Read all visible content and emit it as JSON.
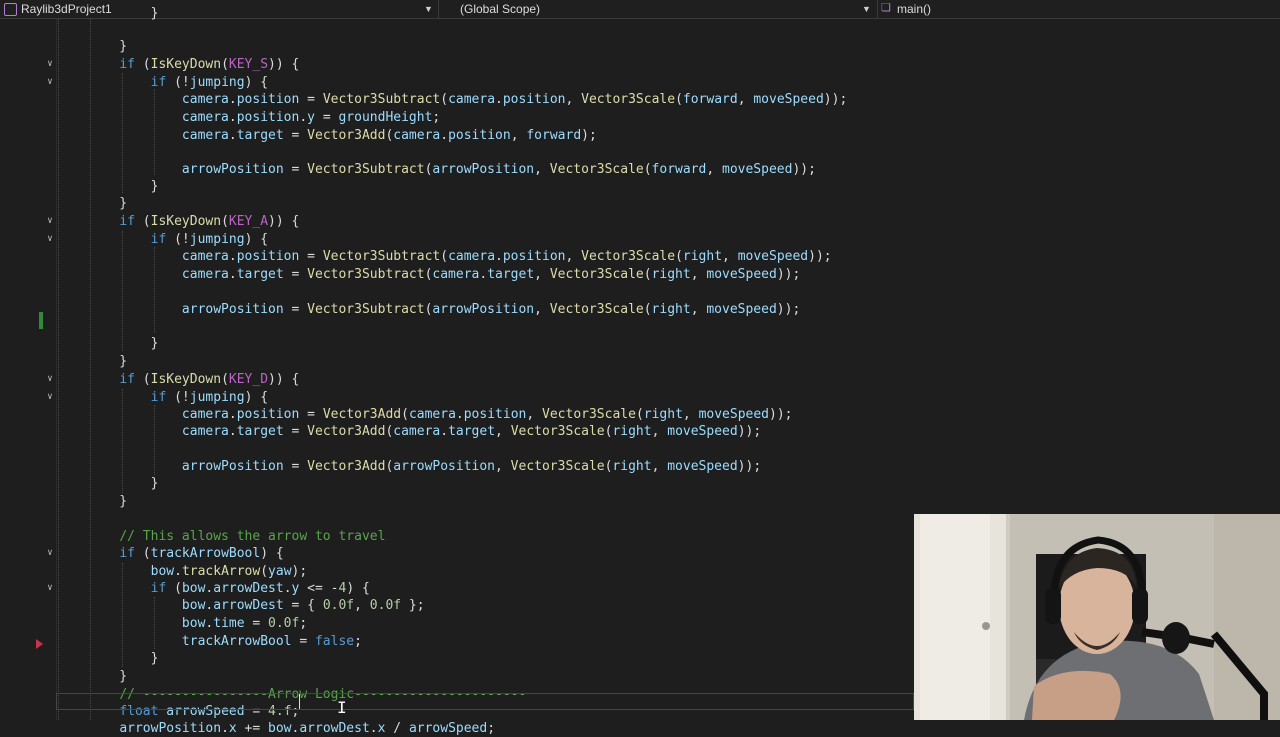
{
  "nav": {
    "project": "Raylib3dProject1",
    "scope": "(Global Scope)",
    "member": "main()",
    "project_icon": "project-icon",
    "member_icon": "cube-icon"
  },
  "colors": {
    "keyword": "#569cd6",
    "function": "#dcdcaa",
    "variable": "#9cdcfe",
    "number": "#b5cea8",
    "macro": "#bd63c5",
    "comment": "#57a64a",
    "background": "#1e1e1e",
    "change_marker": "#2e8b3a",
    "breakpoint": "#c8324a"
  },
  "code_lines": [
    "        }",
    "    }",
    "    if (IsKeyDown(KEY_S)) {",
    "        if (!jumping) {",
    "            camera.position = Vector3Subtract(camera.position, Vector3Scale(forward, moveSpeed));",
    "            camera.position.y = groundHeight;",
    "            camera.target = Vector3Add(camera.position, forward);",
    "",
    "            arrowPosition = Vector3Subtract(arrowPosition, Vector3Scale(forward, moveSpeed));",
    "        }",
    "    }",
    "    if (IsKeyDown(KEY_A)) {",
    "        if (!jumping) {",
    "            camera.position = Vector3Subtract(camera.position, Vector3Scale(right, moveSpeed));",
    "            camera.target = Vector3Subtract(camera.target, Vector3Scale(right, moveSpeed));",
    "",
    "            arrowPosition = Vector3Subtract(arrowPosition, Vector3Scale(right, moveSpeed));",
    "",
    "        }",
    "    }",
    "    if (IsKeyDown(KEY_D)) {",
    "        if (!jumping) {",
    "            camera.position = Vector3Add(camera.position, Vector3Scale(right, moveSpeed));",
    "            camera.target = Vector3Add(camera.target, Vector3Scale(right, moveSpeed));",
    "",
    "            arrowPosition = Vector3Add(arrowPosition, Vector3Scale(right, moveSpeed));",
    "        }",
    "    }",
    "",
    "    // This allows the arrow to travel",
    "    if (trackArrowBool) {",
    "        bow.trackArrow(yaw);",
    "        if (bow.arrowDest.y <= -4) {",
    "            bow.arrowDest = { 0.0f, 0.0f };",
    "            bow.time = 0.0f;",
    "            trackArrowBool = false;",
    "        }",
    "    }",
    "    // ----------------Arrow Logic----------------------",
    "    float arrowSpeed = 4.f;",
    "    arrowPosition.x += bow.arrowDest.x / arrowSpeed;"
  ]
}
